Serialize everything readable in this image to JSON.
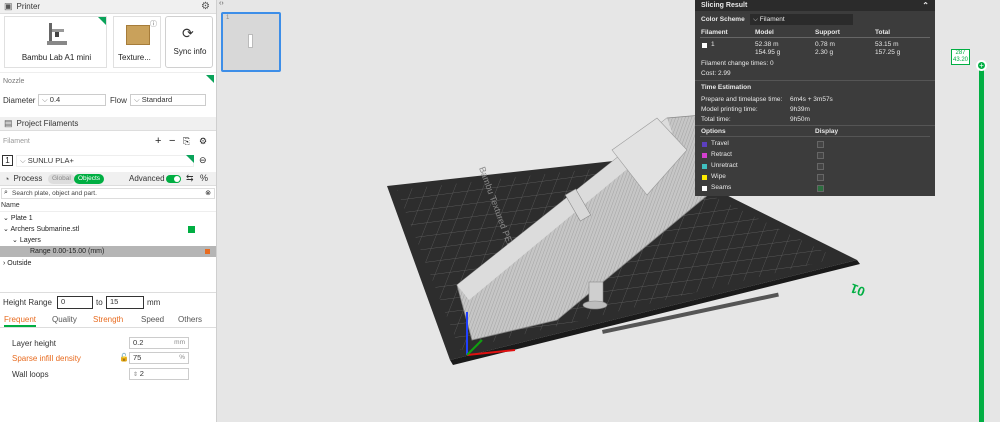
{
  "printer": {
    "title": "Printer",
    "name": "Bambu Lab A1 mini",
    "plate_label": "Texture...",
    "sync_label": "Sync info"
  },
  "nozzle": {
    "title": "Nozzle",
    "diameter_label": "Diameter",
    "diameter_value": "0.4",
    "flow_label": "Flow",
    "flow_value": "Standard"
  },
  "filaments": {
    "title": "Project Filaments",
    "field_label": "Filament",
    "item_index": "1",
    "item_name": "SUNLU PLA+"
  },
  "process": {
    "title": "Process",
    "global_label": "Global",
    "objects_label": "Objects",
    "advanced_label": "Advanced",
    "search_placeholder": "Search plate, object and part.",
    "name_header": "Name"
  },
  "tree": {
    "plate": "Plate 1",
    "object": "Archers Submarine.stl",
    "layers": "Layers",
    "range": "Range 0.00-15.00 (mm)",
    "outside": "Outside"
  },
  "height_range": {
    "label": "Height Range",
    "from": "0",
    "to_label": "to",
    "to": "15",
    "unit": "mm"
  },
  "tabs": [
    "Frequent",
    "Quality",
    "Strength",
    "Speed",
    "Others"
  ],
  "settings": [
    {
      "label": "Layer height",
      "value": "0.2",
      "unit": "mm"
    },
    {
      "label": "Sparse infill density",
      "value": "75",
      "unit": "%"
    },
    {
      "label": "Wall loops",
      "value": "2",
      "unit": ""
    }
  ],
  "result": {
    "title": "Slicing Result",
    "color_scheme_label": "Color Scheme",
    "color_scheme_value": "Filament",
    "headers": [
      "Filament",
      "Model",
      "Support",
      "Total"
    ],
    "row": {
      "id": "1",
      "model_len": "52.38 m",
      "model_wt": "154.95 g",
      "support_len": "0.78 m",
      "support_wt": "2.30 g",
      "total_len": "53.15 m",
      "total_wt": "157.25 g"
    },
    "change_times": "Filament change times:  0",
    "cost": "Cost:  2.99",
    "time_title": "Time Estimation",
    "times": [
      {
        "label": "Prepare and timelapse time:",
        "value": "6m4s + 3m57s"
      },
      {
        "label": "Model printing time:",
        "value": "9h39m"
      },
      {
        "label": "Total time:",
        "value": "9h50m"
      }
    ],
    "options_header": "Options",
    "display_header": "Display",
    "options": [
      {
        "label": "Travel",
        "color": "#5c3fbf"
      },
      {
        "label": "Retract",
        "color": "#d43fcf"
      },
      {
        "label": "Unretract",
        "color": "#3fbfbf"
      },
      {
        "label": "Wipe",
        "color": "#ffeb00"
      },
      {
        "label": "Seams",
        "color": "#ffffff"
      }
    ]
  },
  "layer_slider": {
    "top_layer": "287",
    "top_height": "43.20"
  },
  "bed": {
    "brand": "Bambu Textured PEI Plate",
    "plate_number": "01"
  },
  "colors": {
    "accent": "#00ae42",
    "panel_bg": "#3c3c3c"
  }
}
